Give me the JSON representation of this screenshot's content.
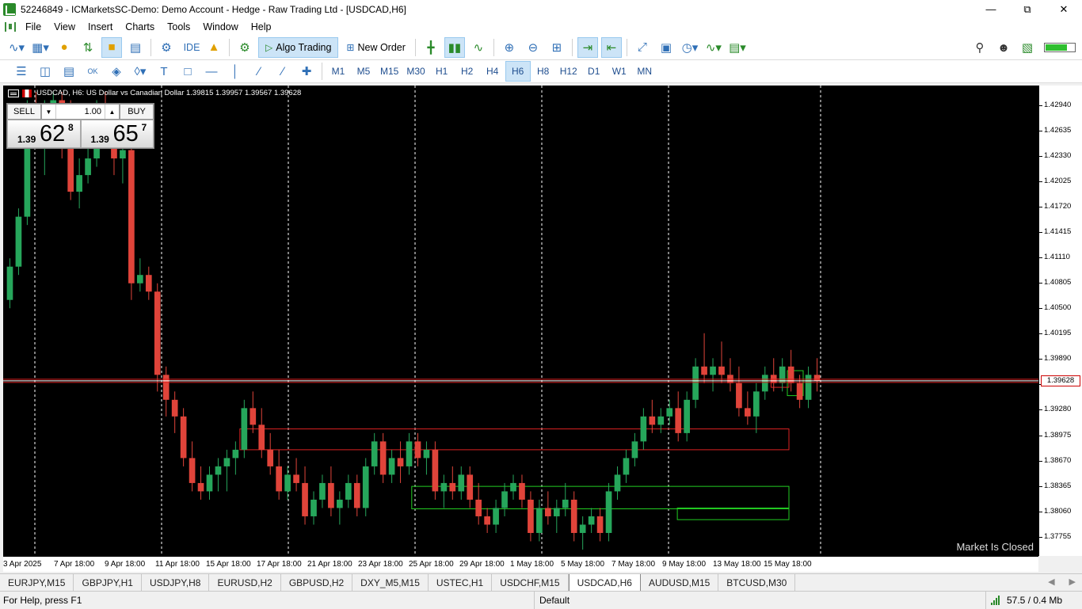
{
  "window": {
    "title": "52246849 - ICMarketsSC-Demo: Demo Account - Hedge - Raw Trading Ltd - [USDCAD,H6]",
    "controls": [
      "minimize-icon",
      "restore-icon",
      "close-icon"
    ]
  },
  "menu": {
    "items": [
      "File",
      "View",
      "Insert",
      "Charts",
      "Tools",
      "Window",
      "Help"
    ]
  },
  "toolbar": {
    "ide_label": "IDE",
    "algo_trading_label": "Algo Trading",
    "new_order_label": "New Order",
    "battery_level": 0.75,
    "icons": [
      "line-chart-icon",
      "market-watch-icon",
      "dollar-icon",
      "signals-icon",
      "folder-icon",
      "database-icon",
      "settings-icon",
      "bag-icon",
      "gear-icon",
      "play-icon",
      "new-order-icon",
      "bar-chart-icon",
      "candle-chart-icon",
      "line-icon",
      "zoom-in-icon",
      "zoom-out-icon",
      "grid-icon",
      "autoscroll-icon",
      "chart-shift-icon",
      "expand-icon",
      "screenshot-icon",
      "clock-icon",
      "indicators-icon",
      "templates-icon",
      "search-icon",
      "account-icon",
      "signal-icon"
    ]
  },
  "timeframes": {
    "items": [
      "M1",
      "M5",
      "M15",
      "M30",
      "H1",
      "H2",
      "H4",
      "H6",
      "H8",
      "H12",
      "D1",
      "W1",
      "MN"
    ],
    "selected": "H6"
  },
  "chart": {
    "header": "USDCAD, H6:  US Dollar vs Canadian Dollar  1.39815 1.39957 1.39567 1.39628",
    "market_status": "Market Is Closed",
    "current_price": "1.39628",
    "price_labels": [
      "1.42940",
      "1.42635",
      "1.42330",
      "1.42025",
      "1.41720",
      "1.41415",
      "1.41110",
      "1.40805",
      "1.40500",
      "1.40195",
      "1.39890",
      "1.39585",
      "1.39280",
      "1.38975",
      "1.38670",
      "1.38365",
      "1.38060",
      "1.37755"
    ],
    "time_labels": [
      "3 Apr 2025",
      "7 Apr 18:00",
      "9 Apr 18:00",
      "11 Apr 18:00",
      "15 Apr 18:00",
      "17 Apr 18:00",
      "21 Apr 18:00",
      "23 Apr 18:00",
      "25 Apr 18:00",
      "29 Apr 18:00",
      "1 May 18:00",
      "5 May 18:00",
      "7 May 18:00",
      "9 May 18:00",
      "13 May 18:00",
      "15 May 18:00"
    ],
    "colors": {
      "background": "#000000",
      "bull": "#26a65b",
      "bear": "#e0443a",
      "grid": "#ffffff"
    }
  },
  "trade_panel": {
    "sell_label": "SELL",
    "buy_label": "BUY",
    "lot": "1.00",
    "sell_small": "1.39",
    "sell_big": "62",
    "sell_sup": "8",
    "buy_small": "1.39",
    "buy_big": "65",
    "buy_sup": "7"
  },
  "tabs": {
    "items": [
      "EURJPY,M15",
      "GBPJPY,H1",
      "USDJPY,H8",
      "EURUSD,H2",
      "GBPUSD,H2",
      "DXY_M5,M15",
      "USTEC,H1",
      "USDCHF,M15",
      "USDCAD,H6",
      "AUDUSD,M15",
      "BTCUSD,M30"
    ],
    "active": "USDCAD,H6"
  },
  "status": {
    "help": "For Help, press F1",
    "profile": "Default",
    "traffic": "57.5 / 0.4 Mb"
  },
  "chart_data": {
    "type": "candlestick",
    "symbol": "USDCAD",
    "timeframe": "H6",
    "ylim": [
      1.376,
      1.431
    ],
    "candles": [
      [
        1.406,
        1.411,
        1.405,
        1.41
      ],
      [
        1.41,
        1.417,
        1.409,
        1.416
      ],
      [
        1.416,
        1.43,
        1.415,
        1.429
      ],
      [
        1.429,
        1.431,
        1.425,
        1.427
      ],
      [
        1.427,
        1.43,
        1.421,
        1.429
      ],
      [
        1.429,
        1.431,
        1.426,
        1.43
      ],
      [
        1.43,
        1.431,
        1.423,
        1.425
      ],
      [
        1.425,
        1.43,
        1.418,
        1.419
      ],
      [
        1.419,
        1.423,
        1.417,
        1.421
      ],
      [
        1.421,
        1.426,
        1.42,
        1.423
      ],
      [
        1.423,
        1.43,
        1.422,
        1.429
      ],
      [
        1.429,
        1.431,
        1.425,
        1.427
      ],
      [
        1.427,
        1.429,
        1.421,
        1.423
      ],
      [
        1.423,
        1.426,
        1.42,
        1.424
      ],
      [
        1.424,
        1.425,
        1.406,
        1.408
      ],
      [
        1.408,
        1.411,
        1.407,
        1.409
      ],
      [
        1.409,
        1.41,
        1.406,
        1.407
      ],
      [
        1.407,
        1.408,
        1.395,
        1.397
      ],
      [
        1.397,
        1.398,
        1.392,
        1.394
      ],
      [
        1.394,
        1.395,
        1.39,
        1.392
      ],
      [
        1.392,
        1.393,
        1.386,
        1.387
      ],
      [
        1.387,
        1.389,
        1.383,
        1.384
      ],
      [
        1.384,
        1.386,
        1.382,
        1.383
      ],
      [
        1.383,
        1.386,
        1.382,
        1.385
      ],
      [
        1.385,
        1.387,
        1.383,
        1.386
      ],
      [
        1.386,
        1.388,
        1.383,
        1.387
      ],
      [
        1.387,
        1.389,
        1.385,
        1.388
      ],
      [
        1.388,
        1.394,
        1.387,
        1.393
      ],
      [
        1.393,
        1.395,
        1.39,
        1.391
      ],
      [
        1.391,
        1.393,
        1.387,
        1.388
      ],
      [
        1.388,
        1.39,
        1.385,
        1.386
      ],
      [
        1.386,
        1.388,
        1.382,
        1.383
      ],
      [
        1.383,
        1.386,
        1.382,
        1.385
      ],
      [
        1.385,
        1.387,
        1.383,
        1.384
      ],
      [
        1.384,
        1.386,
        1.379,
        1.38
      ],
      [
        1.38,
        1.383,
        1.379,
        1.382
      ],
      [
        1.382,
        1.385,
        1.381,
        1.384
      ],
      [
        1.384,
        1.386,
        1.38,
        1.381
      ],
      [
        1.381,
        1.383,
        1.379,
        1.382
      ],
      [
        1.382,
        1.385,
        1.381,
        1.384
      ],
      [
        1.384,
        1.385,
        1.38,
        1.381
      ],
      [
        1.381,
        1.387,
        1.38,
        1.386
      ],
      [
        1.386,
        1.39,
        1.385,
        1.389
      ],
      [
        1.389,
        1.39,
        1.384,
        1.385
      ],
      [
        1.385,
        1.388,
        1.384,
        1.387
      ],
      [
        1.387,
        1.389,
        1.384,
        1.386
      ],
      [
        1.386,
        1.39,
        1.385,
        1.389
      ],
      [
        1.389,
        1.39,
        1.386,
        1.387
      ],
      [
        1.387,
        1.389,
        1.385,
        1.388
      ],
      [
        1.388,
        1.389,
        1.382,
        1.383
      ],
      [
        1.383,
        1.385,
        1.381,
        1.384
      ],
      [
        1.384,
        1.386,
        1.382,
        1.383
      ],
      [
        1.383,
        1.386,
        1.382,
        1.385
      ],
      [
        1.385,
        1.386,
        1.381,
        1.382
      ],
      [
        1.382,
        1.384,
        1.379,
        1.38
      ],
      [
        1.38,
        1.381,
        1.378,
        1.379
      ],
      [
        1.379,
        1.382,
        1.378,
        1.381
      ],
      [
        1.381,
        1.384,
        1.38,
        1.383
      ],
      [
        1.383,
        1.385,
        1.382,
        1.384
      ],
      [
        1.384,
        1.385,
        1.381,
        1.382
      ],
      [
        1.382,
        1.383,
        1.377,
        1.378
      ],
      [
        1.378,
        1.382,
        1.377,
        1.381
      ],
      [
        1.381,
        1.383,
        1.379,
        1.38
      ],
      [
        1.38,
        1.382,
        1.378,
        1.381
      ],
      [
        1.381,
        1.384,
        1.38,
        1.382
      ],
      [
        1.382,
        1.383,
        1.377,
        1.378
      ],
      [
        1.378,
        1.38,
        1.376,
        1.379
      ],
      [
        1.379,
        1.381,
        1.378,
        1.38
      ],
      [
        1.38,
        1.381,
        1.377,
        1.378
      ],
      [
        1.378,
        1.384,
        1.377,
        1.383
      ],
      [
        1.383,
        1.386,
        1.382,
        1.385
      ],
      [
        1.385,
        1.388,
        1.384,
        1.387
      ],
      [
        1.387,
        1.39,
        1.386,
        1.389
      ],
      [
        1.389,
        1.393,
        1.388,
        1.392
      ],
      [
        1.392,
        1.394,
        1.39,
        1.391
      ],
      [
        1.391,
        1.393,
        1.39,
        1.392
      ],
      [
        1.392,
        1.394,
        1.391,
        1.393
      ],
      [
        1.393,
        1.395,
        1.389,
        1.39
      ],
      [
        1.39,
        1.395,
        1.389,
        1.394
      ],
      [
        1.394,
        1.399,
        1.393,
        1.398
      ],
      [
        1.398,
        1.402,
        1.396,
        1.397
      ],
      [
        1.397,
        1.399,
        1.395,
        1.398
      ],
      [
        1.398,
        1.401,
        1.396,
        1.397
      ],
      [
        1.397,
        1.399,
        1.395,
        1.396
      ],
      [
        1.396,
        1.398,
        1.392,
        1.393
      ],
      [
        1.393,
        1.395,
        1.391,
        1.392
      ],
      [
        1.392,
        1.396,
        1.39,
        1.395
      ],
      [
        1.395,
        1.398,
        1.394,
        1.397
      ],
      [
        1.397,
        1.399,
        1.395,
        1.396
      ],
      [
        1.396,
        1.399,
        1.395,
        1.398
      ],
      [
        1.398,
        1.4,
        1.395,
        1.396
      ],
      [
        1.396,
        1.397,
        1.393,
        1.394
      ],
      [
        1.394,
        1.398,
        1.393,
        1.397
      ],
      [
        1.397,
        1.399,
        1.395,
        1.3963
      ]
    ],
    "zones": [
      {
        "color": "red",
        "from": 1.388,
        "to": 1.3905,
        "start_index": 30
      },
      {
        "color": "green",
        "from": 1.3809,
        "to": 1.3836,
        "start_index": 52
      },
      {
        "color": "green",
        "from": 1.3796,
        "to": 1.381,
        "start_index": 86
      },
      {
        "color": "green",
        "from": 1.3945,
        "to": 1.3975,
        "start_index": 105
      },
      {
        "color": "red",
        "from": 1.3955,
        "to": 1.3965,
        "start_index": 98
      }
    ]
  }
}
